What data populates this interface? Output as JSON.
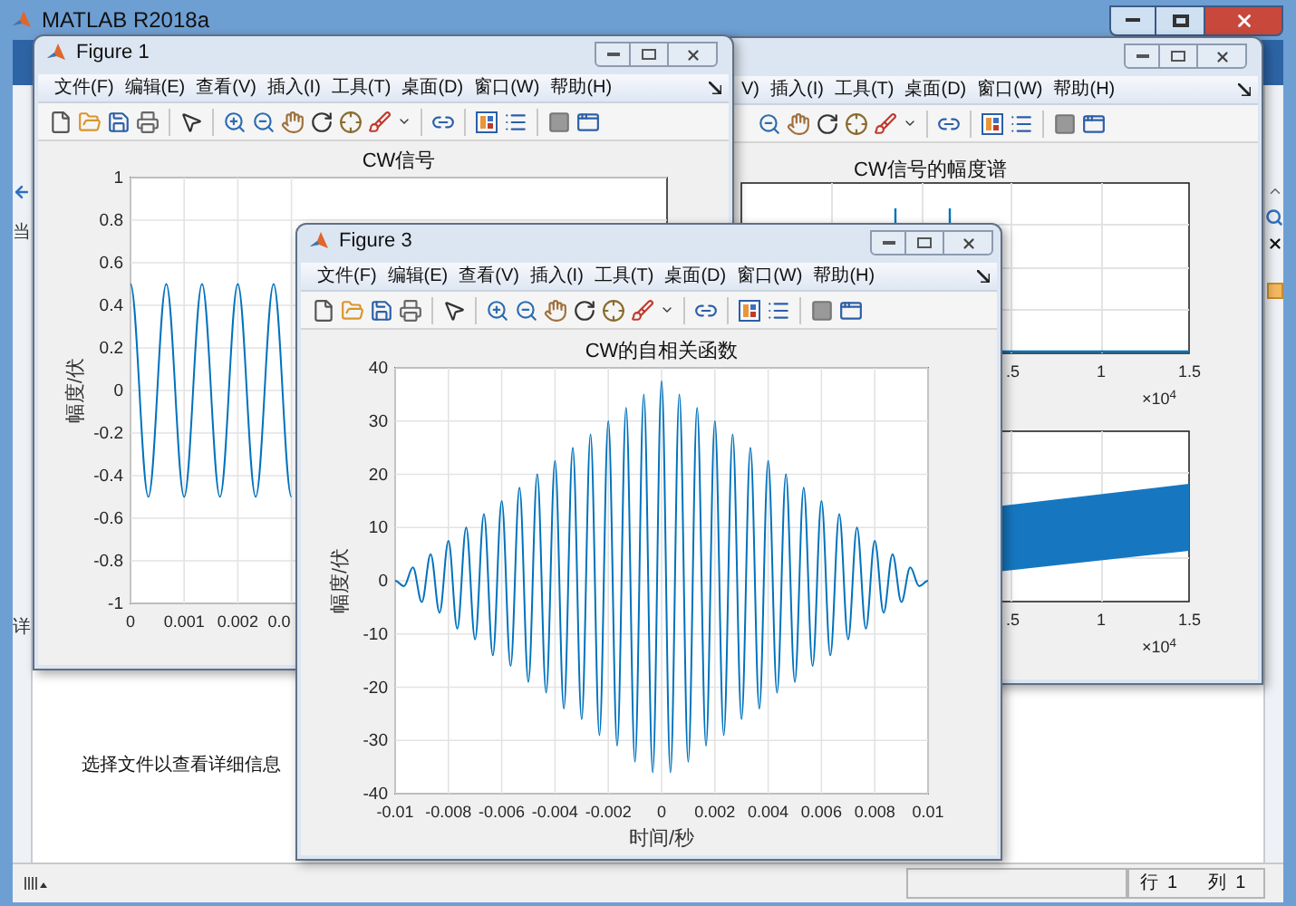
{
  "app": {
    "title": "MATLAB R2018a",
    "panel_tabs": [
      "当",
      "详"
    ],
    "details_hint": "选择文件以查看详细信息",
    "status_bar": {
      "row_label": "行",
      "row": "1",
      "col_label": "列",
      "col": "1"
    }
  },
  "figures": [
    {
      "kind": "spectrum",
      "menu": [
        "V)",
        "插入(I)",
        "工具(T)",
        "桌面(D)",
        "窗口(W)",
        "帮助(H)"
      ],
      "plots": [
        {
          "kind": "spectrum",
          "title": "CW信号的幅度谱",
          "xtick_labels": [
            ".5",
            "1",
            "1.5"
          ],
          "exponent": "×10$^{4}$"
        },
        {
          "kind": "band",
          "xtick_labels": [
            ".5",
            "1",
            "1.5"
          ],
          "exponent": "×10$^{4}$"
        }
      ]
    },
    {
      "kind": "line",
      "title": "Figure 1",
      "menu": [
        "文件(F)",
        "编辑(E)",
        "查看(V)",
        "插入(I)",
        "工具(T)",
        "桌面(D)",
        "窗口(W)",
        "帮助(H)"
      ],
      "chart_data": {
        "type": "line",
        "title": "CW信号",
        "ylabel": "幅度/伏",
        "grid": true,
        "x": [
          0,
          0.000333,
          0.000667,
          0.001,
          0.001333,
          0.001667,
          0.002,
          0.002333,
          0.002667,
          0.003
        ],
        "series": [
          {
            "color": "#0072bd",
            "values": [
              0.5,
              -0.5,
              0.5,
              -0.5,
              0.5,
              -0.5,
              0.5,
              -0.5,
              0.5,
              -0.5
            ]
          }
        ],
        "xlim": [
          0,
          0.01
        ],
        "ylim": [
          -1,
          1
        ],
        "xticks": [
          0,
          0.001,
          0.002,
          {
            "value": 0.003,
            "label": "0.0"
          }
        ],
        "yticks": [
          -1,
          -0.8,
          -0.6,
          -0.4,
          -0.2,
          0,
          0.2,
          0.4,
          0.6,
          0.8,
          1
        ]
      }
    },
    {
      "kind": "line",
      "title": "Figure 3",
      "menu": [
        "文件(F)",
        "编辑(E)",
        "查看(V)",
        "插入(I)",
        "工具(T)",
        "桌面(D)",
        "窗口(W)",
        "帮助(H)"
      ],
      "chart_data": {
        "type": "line",
        "grid": true,
        "title": "CW的自相关函数",
        "xlabel": "时间/秒",
        "ylabel": "幅度/伏",
        "x": [
          -0.01,
          -0.009667,
          -0.009333,
          -0.009,
          -0.008667,
          -0.008333,
          -0.008,
          -0.007667,
          -0.007333,
          -0.007,
          -0.006667,
          -0.006333,
          -0.006,
          -0.005667,
          -0.005333,
          -0.005,
          -0.004667,
          -0.004333,
          -0.004,
          -0.003667,
          -0.003333,
          -0.003,
          -0.002667,
          -0.002333,
          -0.002,
          -0.001667,
          -0.001333,
          -0.001,
          -0.000667,
          -0.000333,
          0,
          0.000333,
          0.000667,
          0.001,
          0.001333,
          0.001667,
          0.002,
          0.002333,
          0.002667,
          0.003,
          0.003333,
          0.003667,
          0.004,
          0.004333,
          0.004667,
          0.005,
          0.005333,
          0.005667,
          0.006,
          0.006333,
          0.006667,
          0.007,
          0.007333,
          0.007667,
          0.008,
          0.008333,
          0.008667,
          0.009,
          0.009333,
          0.009667,
          0.01
        ],
        "series": [
          {
            "color": "#0072bd",
            "values": [
              0,
              -1,
              2.5,
              -4,
              5,
              -6,
              7.5,
              -9,
              10,
              -11,
              12.5,
              -14,
              15,
              -16,
              17.5,
              -19,
              20,
              -21,
              22.5,
              -24,
              25,
              -26,
              27.5,
              -29,
              30,
              -31,
              32.5,
              -34,
              35,
              -36,
              37.5,
              -36,
              35,
              -34,
              32.5,
              -31,
              30,
              -29,
              27.5,
              -26,
              25,
              -24,
              22.5,
              -21,
              20,
              -19,
              17.5,
              -16,
              15,
              -14,
              12.5,
              -11,
              10,
              -9,
              7.5,
              -6,
              5,
              -4,
              2.5,
              -1,
              0
            ]
          }
        ],
        "xlim": [
          -0.01,
          0.01
        ],
        "ylim": [
          -40,
          40
        ],
        "xticks": [
          -0.01,
          -0.008,
          -0.006,
          -0.004,
          -0.002,
          0,
          0.002,
          0.004,
          0.006,
          0.008,
          0.01
        ],
        "yticks": [
          -40,
          -30,
          -20,
          -10,
          0,
          10,
          20,
          30,
          40
        ]
      }
    }
  ]
}
